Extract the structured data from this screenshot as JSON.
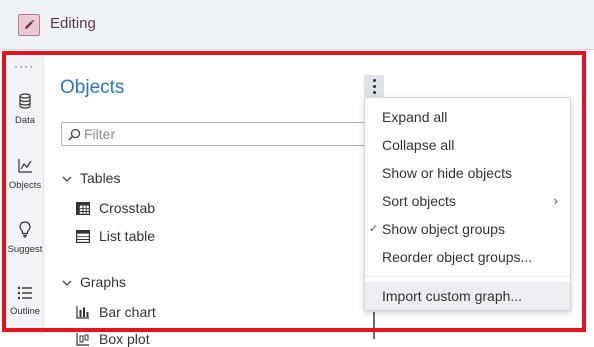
{
  "topbar": {
    "title": "Editing",
    "icon": "pencil-icon"
  },
  "rail": {
    "items": [
      {
        "label": "Data",
        "icon": "database-icon"
      },
      {
        "label": "Objects",
        "icon": "line-chart-icon"
      },
      {
        "label": "Suggest",
        "icon": "lightbulb-icon"
      },
      {
        "label": "Outline",
        "icon": "list-icon"
      }
    ]
  },
  "panel": {
    "title": "Objects",
    "filter_placeholder": "Filter",
    "sections": [
      {
        "label": "Tables",
        "items": [
          "Crosstab",
          "List table"
        ]
      },
      {
        "label": "Graphs",
        "items": [
          "Bar chart",
          "Box plot"
        ]
      }
    ]
  },
  "menu": {
    "items": [
      "Expand all",
      "Collapse all",
      "Show or hide objects",
      "Sort objects",
      "Show object groups",
      "Reorder object groups...",
      "Import custom graph..."
    ],
    "checked_item": "Show object groups",
    "submenu_item": "Sort objects",
    "highlighted_item": "Import custom graph..."
  },
  "colors": {
    "accent": "#2b78c2",
    "outline": "#e3141f",
    "edit_badge": "#e9c9d6"
  }
}
